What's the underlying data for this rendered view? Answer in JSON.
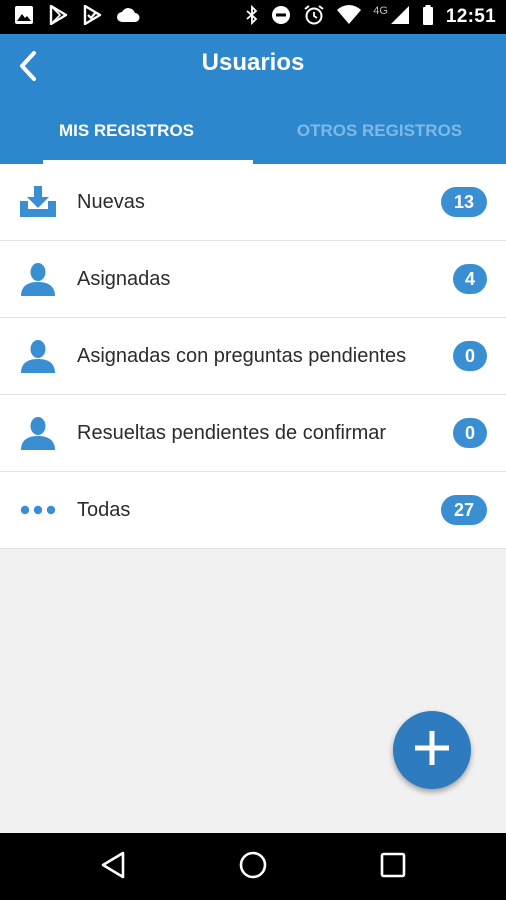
{
  "status_bar": {
    "time": "12:51",
    "network": "4G",
    "left_icons": [
      "image-icon",
      "play-store-icon",
      "play-check-icon",
      "cloud-icon"
    ],
    "right_icons": [
      "bluetooth-icon",
      "do-not-disturb-icon",
      "alarm-icon",
      "wifi-icon",
      "signal-icon",
      "battery-icon"
    ]
  },
  "app_bar": {
    "title": "Usuarios",
    "back_icon": "chevron-left-icon"
  },
  "tabs": [
    {
      "label": "MIS REGISTROS",
      "active": true
    },
    {
      "label": "OTROS REGISTROS",
      "active": false
    }
  ],
  "list": [
    {
      "label": "Nuevas",
      "count": "13",
      "icon": "download-tray-icon"
    },
    {
      "label": "Asignadas",
      "count": "4",
      "icon": "person-icon"
    },
    {
      "label": "Asignadas con preguntas pendientes",
      "count": "0",
      "icon": "person-icon"
    },
    {
      "label": "Resueltas pendientes de confirmar",
      "count": "0",
      "icon": "person-icon"
    },
    {
      "label": "Todas",
      "count": "27",
      "icon": "more-dots-icon"
    }
  ],
  "fab": {
    "icon": "plus-icon"
  },
  "colors": {
    "primary": "#2d87cc",
    "badge": "#3a8fd3",
    "icon": "#3a8fd3",
    "background": "#f1f1f1",
    "inactive_tab": "#7fb8e6"
  }
}
